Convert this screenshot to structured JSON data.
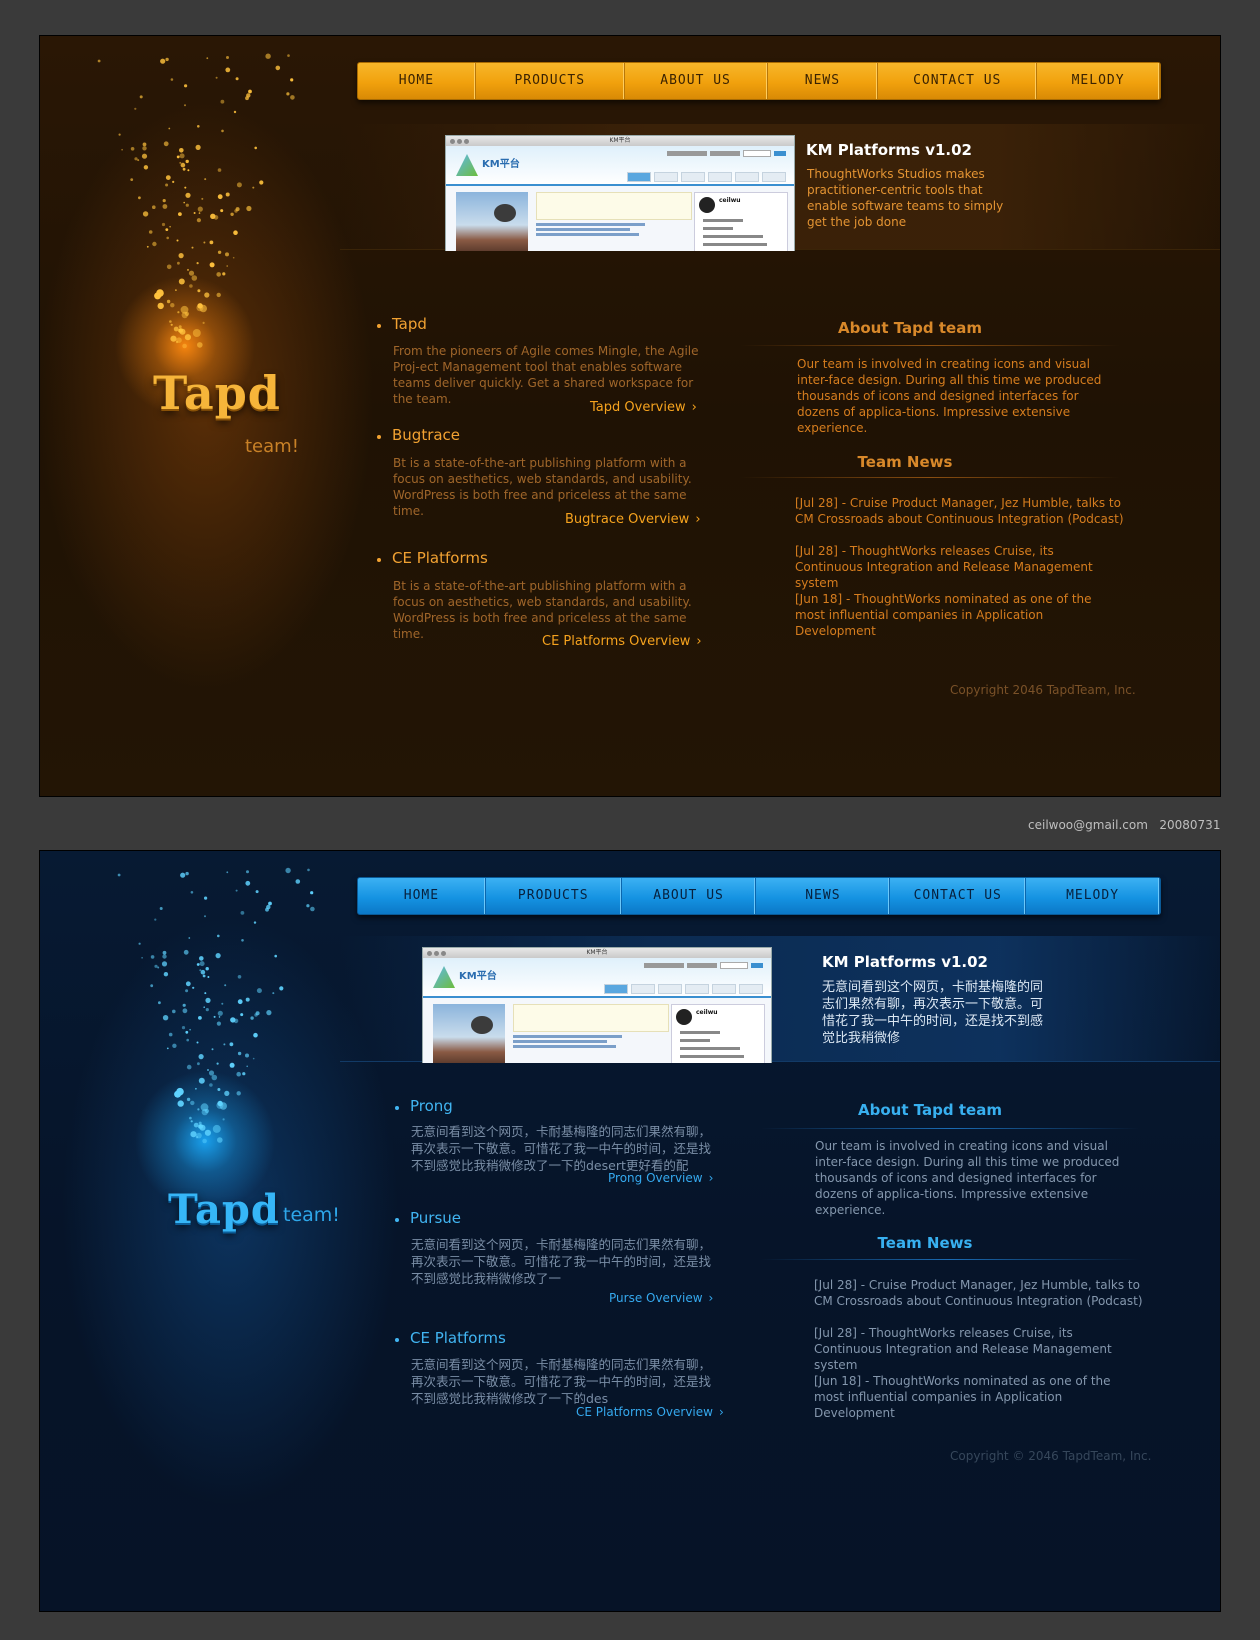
{
  "credit": {
    "email": "ceilwoo@gmail.com",
    "date": "20080731"
  },
  "colors": {
    "orange_accent": "#f2a232",
    "blue_accent": "#41b5f2",
    "orange_nav": "#f1a10d",
    "blue_nav": "#1593e2"
  },
  "orange": {
    "logo": {
      "main": "Tapd",
      "sub": "team!"
    },
    "nav": [
      "HOME",
      "PRODUCTS",
      "ABOUT US",
      "NEWS",
      "CONTACT US",
      "MELODY"
    ],
    "feature": {
      "title": "KM Platforms v1.02",
      "desc": "ThoughtWorks Studios makes practitioner-centric tools that enable software teams to simply get the job done",
      "shot": {
        "window_title": "KM平台",
        "brand": "KM平台",
        "user": "ceilwu"
      }
    },
    "items": [
      {
        "title": "Tapd",
        "desc": "From the pioneers of Agile comes Mingle, the Agile Proj-ect Management tool that enables software teams deliver quickly. Get a shared workspace for the team.",
        "link": "Tapd Overview"
      },
      {
        "title": "Bugtrace",
        "desc": "Bt is a state-of-the-art publishing platform with a focus on aesthetics, web standards, and usability. WordPress is both free and priceless at the same time.",
        "link": "Bugtrace Overview"
      },
      {
        "title": "CE Platforms",
        "desc": "Bt is a state-of-the-art publishing platform with a focus on aesthetics, web standards, and usability. WordPress is both free and priceless at the same time.",
        "link": "CE Platforms Overview"
      }
    ],
    "about": {
      "title": "About Tapd team",
      "text": "Our team is involved in creating icons and visual inter-face design. During all this time we produced thousands of icons and designed interfaces for dozens of applica-tions. Impressive extensive experience."
    },
    "news": {
      "title": "Team News",
      "items": [
        "[Jul 28] - Cruise Product Manager, Jez Humble, talks to CM Crossroads about Continuous Integration (Podcast)",
        "[Jul 28] - ThoughtWorks releases Cruise, its Continuous Integration and Release Management system",
        "[Jun 18] - ThoughtWorks nominated as one of the most influential companies in Application Development"
      ]
    },
    "copyright": "Copyright 2046 TapdTeam, Inc."
  },
  "blue": {
    "logo": {
      "main": "Tapd",
      "sub": "team!"
    },
    "nav": [
      "HOME",
      "PRODUCTS",
      "ABOUT US",
      "NEWS",
      "CONTACT US",
      "MELODY"
    ],
    "feature": {
      "title": "KM Platforms v1.02",
      "desc": "无意间看到这个网页，卡耐基梅隆的同志们果然有聊，再次表示一下敬意。可惜花了我一中午的时间，还是找不到感觉比我稍微修",
      "shot": {
        "window_title": "KM平台",
        "brand": "KM平台",
        "user": "ceilwu"
      }
    },
    "items": [
      {
        "title": "Prong",
        "desc": "无意间看到这个网页，卡耐基梅隆的同志们果然有聊，再次表示一下敬意。可惜花了我一中午的时间，还是找不到感觉比我稍微修改了一下的desert更好看的配",
        "link": "Prong Overview"
      },
      {
        "title": "Pursue",
        "desc": "无意间看到这个网页，卡耐基梅隆的同志们果然有聊，再次表示一下敬意。可惜花了我一中午的时间，还是找不到感觉比我稍微修改了一",
        "link": "Purse Overview"
      },
      {
        "title": "CE Platforms",
        "desc": "无意间看到这个网页，卡耐基梅隆的同志们果然有聊，再次表示一下敬意。可惜花了我一中午的时间，还是找不到感觉比我稍微修改了一下的des",
        "link": "CE Platforms Overview"
      }
    ],
    "about": {
      "title": "About Tapd team",
      "text": "Our team is involved in creating icons and visual inter-face design. During all this time we produced thousands of icons and designed interfaces for dozens of applica-tions. Impressive extensive experience."
    },
    "news": {
      "title": "Team News",
      "items": [
        "[Jul 28] - Cruise Product Manager, Jez Humble, talks to CM Crossroads about Continuous Integration (Podcast)",
        "[Jul 28] - ThoughtWorks releases Cruise, its Continuous Integration and Release Management system",
        "[Jun 18] - ThoughtWorks nominated as one of the most influential companies in Application Development"
      ]
    },
    "copyright": "Copyright © 2046 TapdTeam, Inc."
  }
}
